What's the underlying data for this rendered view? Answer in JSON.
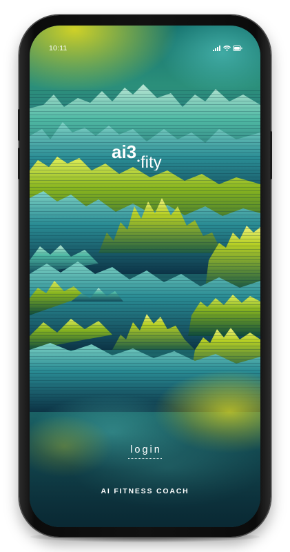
{
  "status_bar": {
    "time": "10:11",
    "icons": [
      "cellular-signal-icon",
      "wifi-icon",
      "battery-icon"
    ]
  },
  "branding": {
    "logo_text": "ai3.fity",
    "tagline": "AI FITNESS COACH"
  },
  "actions": {
    "login_label": "login"
  },
  "colors": {
    "text": "#ffffff",
    "teal": "#1f8e8e",
    "lime": "#c7d61e",
    "deep_teal": "#0f3f40"
  }
}
